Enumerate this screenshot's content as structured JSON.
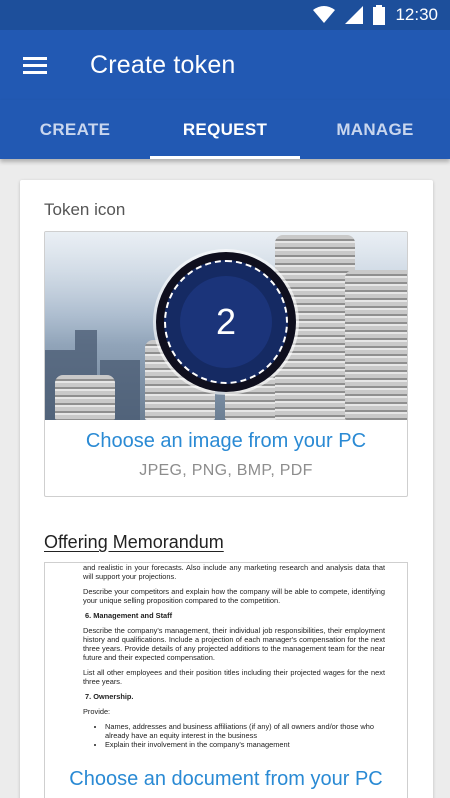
{
  "status_bar": {
    "time": "12:30"
  },
  "app_bar": {
    "title": "Create token"
  },
  "tabs": [
    {
      "label": "CREATE",
      "active": false
    },
    {
      "label": "REQUEST",
      "active": true
    },
    {
      "label": "MANAGE",
      "active": false
    }
  ],
  "token_icon": {
    "label": "Token icon",
    "badge_number": "2",
    "choose_label": "Choose an image from your PC",
    "formats": "JPEG, PNG, BMP, PDF"
  },
  "memorandum": {
    "label": "Offering Memorandum",
    "choose_label": "Choose an document from your PC",
    "doc_lines": {
      "p1": "and realistic in your forecasts. Also include any marketing research and analysis data that will support your projections.",
      "p2": "Describe your competitors and explain how the company will be able to compete, identifying your unique selling proposition compared to the competition.",
      "h6": "6.   Management and Staff",
      "p3": "Describe the company's management, their individual job responsibilities, their employment history and qualifications. Include a projection of each manager's compensation for the next three years. Provide details of any projected additions to the management team for the near future and their expected compensation.",
      "p4": "List all other employees and their position titles including their projected wages for the next three years.",
      "h7": "7.   Ownership.",
      "p5": "Provide:",
      "b1": "Names, addresses and business affiliations (if any) of all owners and/or those who already have an equity interest in the business",
      "b2": "Explain their involvement in the company's management"
    }
  },
  "colors": {
    "app_bar": "#2259b3",
    "status_bar": "#1d4f9b",
    "link": "#2a8ad4"
  }
}
